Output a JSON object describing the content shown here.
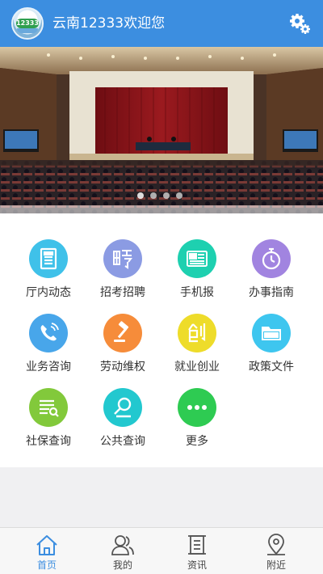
{
  "header": {
    "title": "云南12333欢迎您",
    "logo_text": "12333",
    "settings_icon": "gear-icon"
  },
  "banner": {
    "slide_count": 4,
    "active_slide": 1
  },
  "grid": {
    "items": [
      {
        "label": "厅内动态",
        "icon": "document-icon",
        "color": "#3fc1e9"
      },
      {
        "label": "招考招聘",
        "icon": "hire-icon",
        "color": "#8b9be3"
      },
      {
        "label": "手机报",
        "icon": "newspaper-icon",
        "color": "#1ed0b0"
      },
      {
        "label": "办事指南",
        "icon": "stopwatch-icon",
        "color": "#a184e0"
      },
      {
        "label": "业务咨询",
        "icon": "phone-icon",
        "color": "#48a6ea"
      },
      {
        "label": "劳动维权",
        "icon": "gavel-icon",
        "color": "#f68c3a"
      },
      {
        "label": "就业创业",
        "icon": "chuang-icon",
        "color": "#eedc2a"
      },
      {
        "label": "政策文件",
        "icon": "folder-icon",
        "color": "#3ec6ef"
      },
      {
        "label": "社保查询",
        "icon": "list-search-icon",
        "color": "#82c93b"
      },
      {
        "label": "公共查询",
        "icon": "magnifier-icon",
        "color": "#22c8cf"
      },
      {
        "label": "更多",
        "icon": "more-dots-icon",
        "color": "#2ecb52"
      }
    ]
  },
  "nav": {
    "items": [
      {
        "label": "首页",
        "icon": "home-icon",
        "active": true
      },
      {
        "label": "我的",
        "icon": "users-icon",
        "active": false
      },
      {
        "label": "资讯",
        "icon": "scroll-icon",
        "active": false
      },
      {
        "label": "附近",
        "icon": "location-pin-icon",
        "active": false
      }
    ],
    "active_color": "#3c8ee0"
  }
}
